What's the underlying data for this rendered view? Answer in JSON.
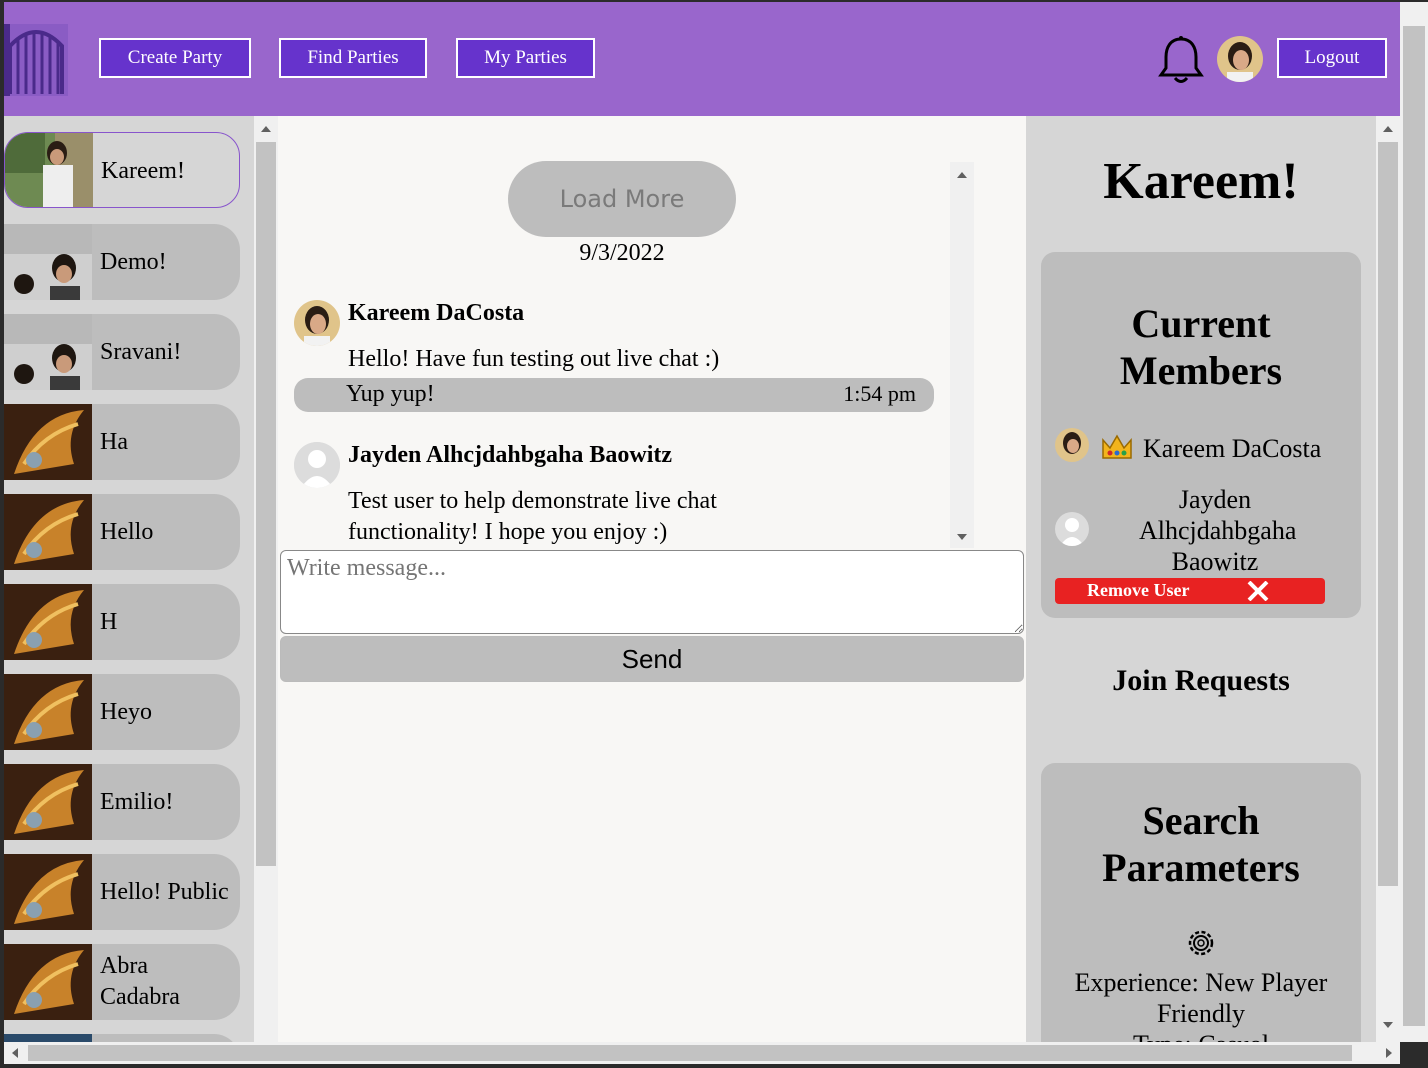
{
  "header": {
    "logo": "castle-gate-logo",
    "nav": [
      {
        "label": "Create Party"
      },
      {
        "label": "Find Parties"
      },
      {
        "label": "My Parties"
      }
    ],
    "bell_icon": "bell-icon",
    "logout_label": "Logout"
  },
  "sidebar": {
    "parties": [
      {
        "label": "Kareem!",
        "active": true
      },
      {
        "label": "Demo!"
      },
      {
        "label": "Sravani!"
      },
      {
        "label": "Ha"
      },
      {
        "label": "Hello"
      },
      {
        "label": "H"
      },
      {
        "label": "Heyo"
      },
      {
        "label": "Emilio!"
      },
      {
        "label": "Hello! Public"
      },
      {
        "label": "Abra Cadabra"
      }
    ]
  },
  "chat": {
    "load_more_label": "Load More",
    "date": "9/3/2022",
    "messages": [
      {
        "author": "Kareem DaCosta",
        "lines": [
          "Hello! Have fun testing out live chat :)",
          "Yup yup!"
        ],
        "time": "1:54 pm"
      },
      {
        "author": "Jayden Alhcjdahbgaha Baowitz",
        "lines": [
          "Test user to help demonstrate live chat functionality! I hope you enjoy :)"
        ]
      }
    ],
    "input_placeholder": "Write message...",
    "send_label": "Send"
  },
  "party_panel": {
    "title": "Kareem!",
    "members_title": "Current Members",
    "members": [
      {
        "name": "Kareem DaCosta",
        "badge": "crown-icon"
      },
      {
        "name": "Jayden Alhcjdahbgaha Baowitz"
      }
    ],
    "remove_label": "Remove User",
    "join_requests_title": "Join Requests",
    "search_title": "Search Parameters",
    "settings_icon": "gear-icon",
    "experience": "Experience: New Player Friendly",
    "type": "Type: Casual"
  },
  "colors": {
    "header": "#9966cc",
    "nav_button": "#6633cc",
    "panel": "#d6d6d6",
    "bubble": "#bdbdbd",
    "danger": "#e82222"
  }
}
